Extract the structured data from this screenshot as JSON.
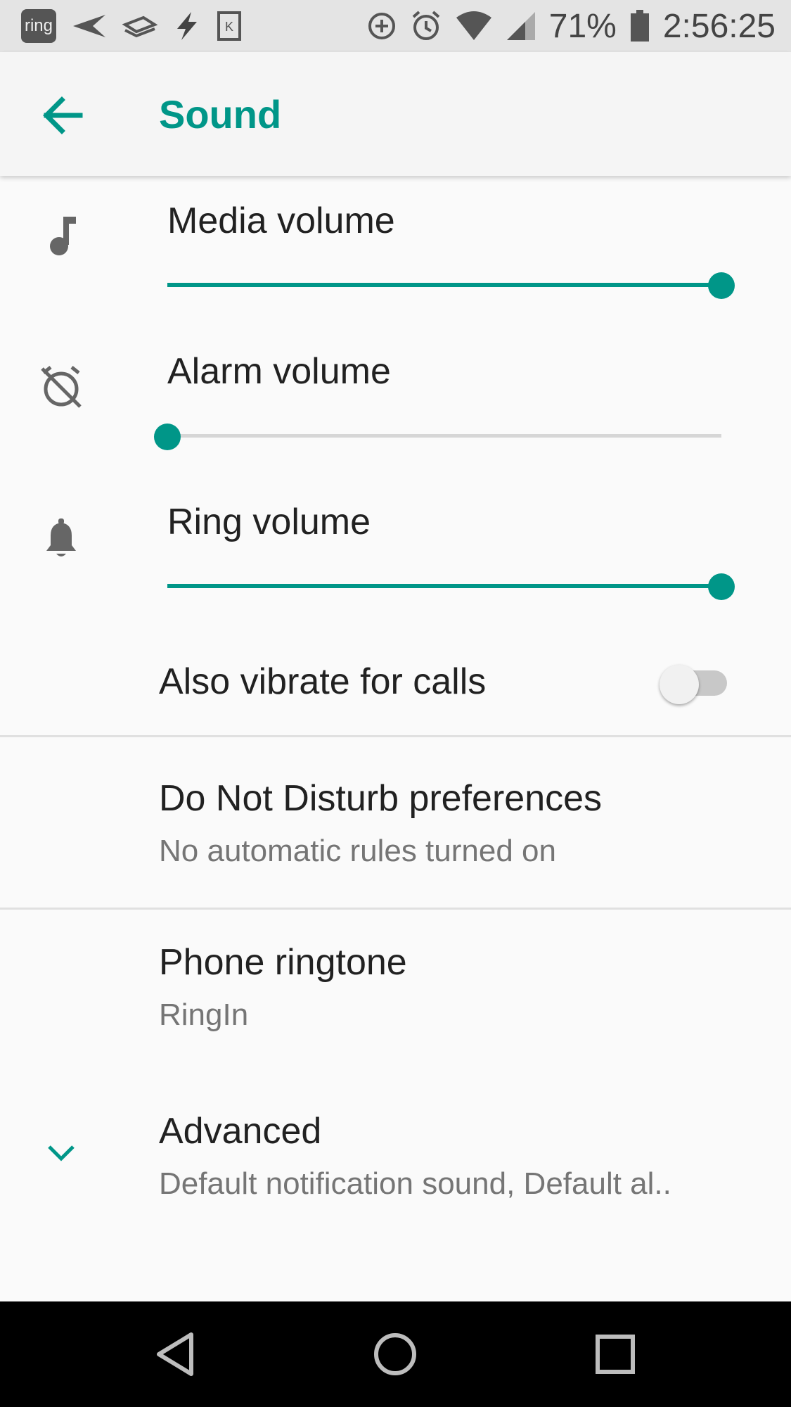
{
  "status_bar": {
    "left_icons": [
      "ring-app-icon",
      "paper-plane-icon",
      "layers-icon",
      "lightning-icon",
      "kindle-icon"
    ],
    "ring_label": "ring",
    "kindle_label": "K",
    "right_icons": [
      "data-saver-icon",
      "alarm-icon",
      "wifi-icon",
      "signal-icon",
      "battery-icon"
    ],
    "battery": "71%",
    "time": "2:56:25"
  },
  "app_bar": {
    "title": "Sound"
  },
  "volumes": [
    {
      "label": "Media volume",
      "icon": "music-note-icon",
      "level": 1.0
    },
    {
      "label": "Alarm volume",
      "icon": "alarm-off-icon",
      "level": 0.0
    },
    {
      "label": "Ring volume",
      "icon": "bell-icon",
      "level": 1.0
    }
  ],
  "vibrate": {
    "label": "Also vibrate for calls",
    "enabled": false
  },
  "dnd": {
    "title": "Do Not Disturb preferences",
    "subtitle": "No automatic rules turned on"
  },
  "ringtone": {
    "title": "Phone ringtone",
    "subtitle": "RingIn"
  },
  "advanced": {
    "title": "Advanced",
    "subtitle": "Default notification sound, Default al.."
  },
  "colors": {
    "accent": "#009688",
    "nav_bar": "#000000",
    "status_bar": "#e4e4e4"
  },
  "nav": [
    "back-icon",
    "home-icon",
    "recents-icon"
  ]
}
